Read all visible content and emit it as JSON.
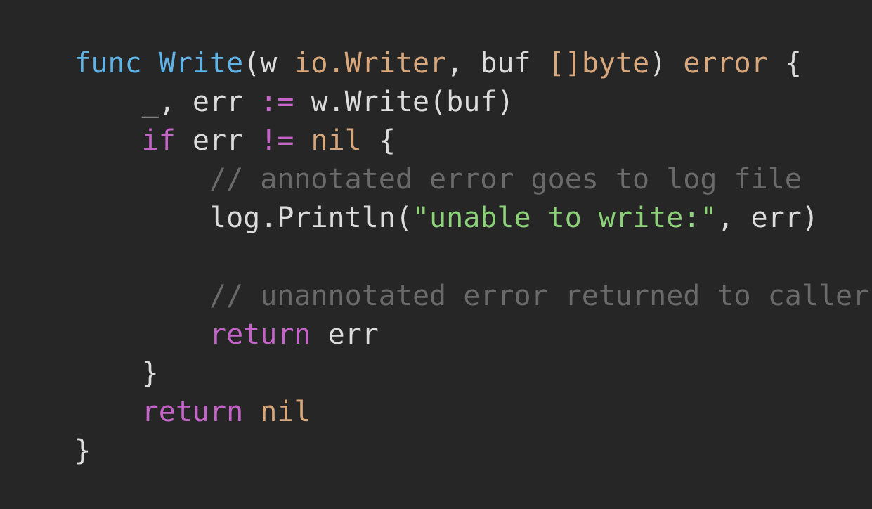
{
  "colors": {
    "background": "#262626",
    "default": "#dcdcdc",
    "keyword": "#c464c8",
    "function_name": "#5fb3e6",
    "type": "#d8a77b",
    "string": "#8dd17a",
    "comment": "#6a6a6a"
  },
  "code": {
    "lines": [
      [
        {
          "text": "func",
          "color": "#5fb3e6"
        },
        {
          "text": " ",
          "color": "#dcdcdc"
        },
        {
          "text": "Write",
          "color": "#5fb3e6"
        },
        {
          "text": "(w ",
          "color": "#dcdcdc"
        },
        {
          "text": "io.Writer",
          "color": "#d8a77b"
        },
        {
          "text": ", buf ",
          "color": "#dcdcdc"
        },
        {
          "text": "[]byte",
          "color": "#d8a77b"
        },
        {
          "text": ") ",
          "color": "#dcdcdc"
        },
        {
          "text": "error",
          "color": "#d8a77b"
        },
        {
          "text": " {",
          "color": "#dcdcdc"
        }
      ],
      [
        {
          "text": "    _, err ",
          "color": "#dcdcdc"
        },
        {
          "text": ":=",
          "color": "#c464c8"
        },
        {
          "text": " w.Write(buf)",
          "color": "#dcdcdc"
        }
      ],
      [
        {
          "text": "    ",
          "color": "#dcdcdc"
        },
        {
          "text": "if",
          "color": "#c464c8"
        },
        {
          "text": " err ",
          "color": "#dcdcdc"
        },
        {
          "text": "!=",
          "color": "#c464c8"
        },
        {
          "text": " ",
          "color": "#dcdcdc"
        },
        {
          "text": "nil",
          "color": "#d8a77b"
        },
        {
          "text": " {",
          "color": "#dcdcdc"
        }
      ],
      [
        {
          "text": "        // annotated error goes to log file",
          "color": "#6a6a6a"
        }
      ],
      [
        {
          "text": "        log.Println(",
          "color": "#dcdcdc"
        },
        {
          "text": "\"unable to write:\"",
          "color": "#8dd17a"
        },
        {
          "text": ", err)",
          "color": "#dcdcdc"
        }
      ],
      [
        {
          "text": "",
          "color": "#dcdcdc"
        }
      ],
      [
        {
          "text": "        // unannotated error returned to caller",
          "color": "#6a6a6a"
        }
      ],
      [
        {
          "text": "        ",
          "color": "#dcdcdc"
        },
        {
          "text": "return",
          "color": "#c464c8"
        },
        {
          "text": " err",
          "color": "#dcdcdc"
        }
      ],
      [
        {
          "text": "    }",
          "color": "#dcdcdc"
        }
      ],
      [
        {
          "text": "    ",
          "color": "#dcdcdc"
        },
        {
          "text": "return",
          "color": "#c464c8"
        },
        {
          "text": " ",
          "color": "#dcdcdc"
        },
        {
          "text": "nil",
          "color": "#d8a77b"
        }
      ],
      [
        {
          "text": "}",
          "color": "#dcdcdc"
        }
      ]
    ]
  }
}
